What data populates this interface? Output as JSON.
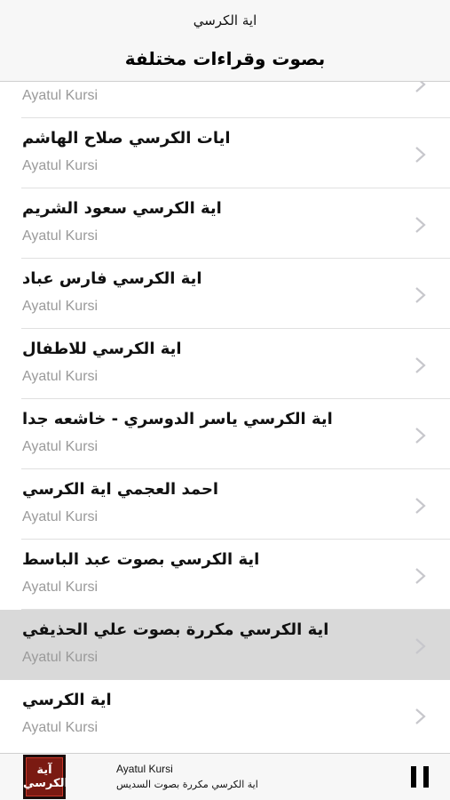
{
  "header": {
    "small_title": "اية الكرسي",
    "big_title": "بصوت وقراءات مختلفة"
  },
  "list": {
    "items": [
      {
        "title": "",
        "subtitle": "Ayatul Kursi"
      },
      {
        "title": "ايات الكرسي صلاح الهاشم",
        "subtitle": "Ayatul Kursi"
      },
      {
        "title": "اية الكرسي سعود الشريم",
        "subtitle": "Ayatul Kursi"
      },
      {
        "title": "اية الكرسي فارس عباد",
        "subtitle": "Ayatul Kursi"
      },
      {
        "title": "اية الكرسي للاطفال",
        "subtitle": "Ayatul Kursi"
      },
      {
        "title": "اية الكرسي ياسر الدوسري - خاشعه جدا",
        "subtitle": "Ayatul Kursi"
      },
      {
        "title": "احمد العجمي اية الكرسي",
        "subtitle": "Ayatul Kursi"
      },
      {
        "title": "اية الكرسي بصوت عبد الباسط",
        "subtitle": "Ayatul Kursi"
      },
      {
        "title": "اية الكرسي مكررة بصوت علي الحذيفي",
        "subtitle": "Ayatul Kursi",
        "selected": true
      },
      {
        "title": "اية الكرسي",
        "subtitle": "Ayatul Kursi"
      }
    ]
  },
  "player": {
    "track_name": "Ayatul Kursi",
    "track_subtitle": "اية الكرسي مكررة بصوت السديس",
    "artwork_text": "آية الكرسي",
    "state_icon": "pause-icon"
  },
  "colors": {
    "header_bg": "#f7f7f7",
    "selected_row_bg": "#d9d9d9",
    "subtitle_gray": "#9a9a9a",
    "chevron_gray": "#c7c7cc"
  }
}
